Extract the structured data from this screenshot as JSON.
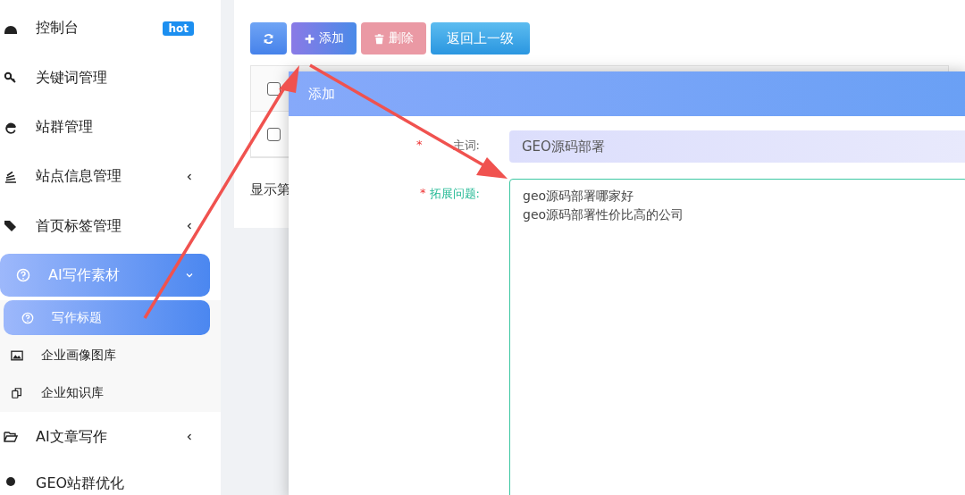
{
  "sidebar": {
    "items": [
      {
        "label": "控制台",
        "badge": "hot"
      },
      {
        "label": "关键词管理"
      },
      {
        "label": "站群管理"
      },
      {
        "label": "站点信息管理",
        "expanded": false
      },
      {
        "label": "首页标签管理",
        "expanded": false
      },
      {
        "label": "AI写作素材",
        "expanded": true,
        "children": [
          {
            "label": "写作标题",
            "selected": true
          },
          {
            "label": "企业画像图库",
            "selected": false
          },
          {
            "label": "企业知识库",
            "selected": false
          }
        ]
      },
      {
        "label": "AI文章写作",
        "expanded": false
      },
      {
        "label": "GEO站群优化"
      }
    ]
  },
  "toolbar": {
    "buttons": [
      {
        "kind": "refresh"
      },
      {
        "kind": "add",
        "label": "添加"
      },
      {
        "kind": "delete",
        "label": "删除",
        "disabled": true
      },
      {
        "kind": "back",
        "label": "返回上一级"
      }
    ]
  },
  "table": {
    "rows": [
      {
        "checked": false
      },
      {
        "checked": false
      }
    ]
  },
  "pagination": {
    "text": "显示第"
  },
  "dialog": {
    "title": "添加",
    "fields": [
      {
        "label": "主词:",
        "required": "*",
        "kind": "input",
        "value": "GEO源码部署"
      },
      {
        "label": "拓展问题:",
        "required": "*",
        "kind": "textarea",
        "value": "geo源码部署哪家好\ngeo源码部署性价比高的公司",
        "focused": true
      }
    ]
  }
}
